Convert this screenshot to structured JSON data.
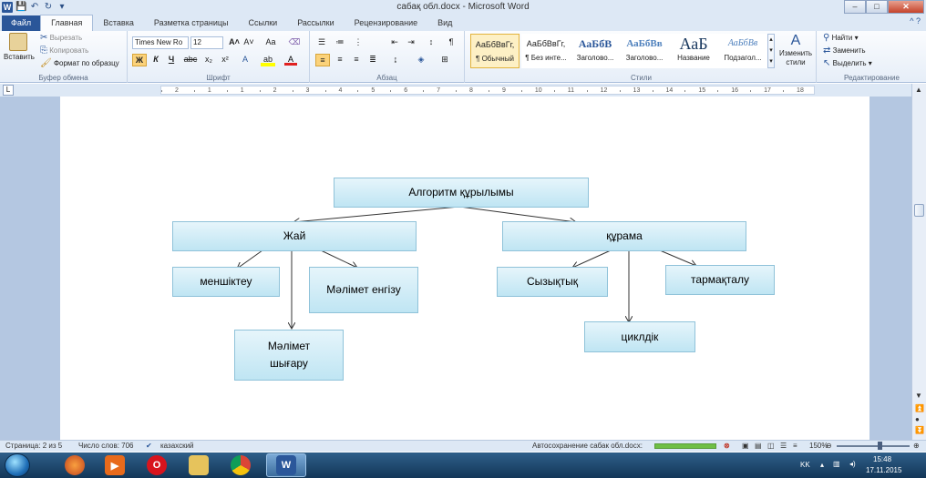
{
  "window": {
    "title": "сабақ обл.docx - Microsoft Word",
    "controls": {
      "minimize": "–",
      "maximize": "□",
      "close": "✕"
    }
  },
  "quick_access": {
    "app_icon": "W",
    "save": "💾",
    "undo": "↶",
    "redo": "↻",
    "customize": "▾"
  },
  "tabs": [
    {
      "label": "Файл"
    },
    {
      "label": "Главная"
    },
    {
      "label": "Вставка"
    },
    {
      "label": "Разметка страницы"
    },
    {
      "label": "Ссылки"
    },
    {
      "label": "Рассылки"
    },
    {
      "label": "Рецензирование"
    },
    {
      "label": "Вид"
    }
  ],
  "ribbon": {
    "clipboard": {
      "label": "Буфер обмена",
      "paste": "Вставить",
      "cut": "Вырезать",
      "copy": "Копировать",
      "format_painter": "Формат по образцу"
    },
    "font": {
      "label": "Шрифт",
      "font_name": "Times New Ro",
      "font_size": "12",
      "bold": "Ж",
      "italic": "К",
      "underline": "Ч",
      "strike": "abc",
      "subscript": "x₂",
      "superscript": "x²",
      "case": "Aa",
      "grow": "A˄",
      "shrink": "A˅"
    },
    "paragraph": {
      "label": "Абзац"
    },
    "styles": {
      "label": "Стили",
      "items": [
        {
          "sample": "АаБбВвГг,",
          "name": "¶ Обычный",
          "selected": true
        },
        {
          "sample": "АаБбВвГг,",
          "name": "¶ Без инте...",
          "selected": false
        },
        {
          "sample": "АаБбВ",
          "name": "Заголово...",
          "selected": false
        },
        {
          "sample": "АаБбВв",
          "name": "Заголово...",
          "selected": false
        },
        {
          "sample": "АаБ",
          "name": "Название",
          "selected": false
        },
        {
          "sample": "АаБбВв",
          "name": "Подзагол...",
          "selected": false
        }
      ],
      "change_styles": "Изменить стили"
    },
    "editing": {
      "label": "Редактирование",
      "find": "Найти",
      "replace": "Заменить",
      "select": "Выделить"
    }
  },
  "ruler": {
    "numbers": [
      "2",
      "1",
      "1",
      "2",
      "3",
      "4",
      "5",
      "6",
      "7",
      "8",
      "9",
      "10",
      "11",
      "12",
      "13",
      "14",
      "15",
      "16",
      "17",
      "18"
    ]
  },
  "diagram": {
    "root": "Алгоритм құрылымы",
    "left": "Жай",
    "right": "құрама",
    "left_children": [
      "меншіктеу",
      "Мәлімет енгізу",
      "Мәлімет шығару"
    ],
    "right_children": [
      "Сызықтық",
      "тармақталу",
      "циклдік"
    ]
  },
  "statusbar": {
    "page": "Страница: 2 из 5",
    "words": "Число слов: 706",
    "language": "казахский",
    "autosave": "Автосохранение сабак обл.docx:",
    "zoom": "150%"
  },
  "taskbar": {
    "clock_time": "15:48",
    "clock_date": "17.11.2015",
    "keyboard_layout": "KK"
  }
}
